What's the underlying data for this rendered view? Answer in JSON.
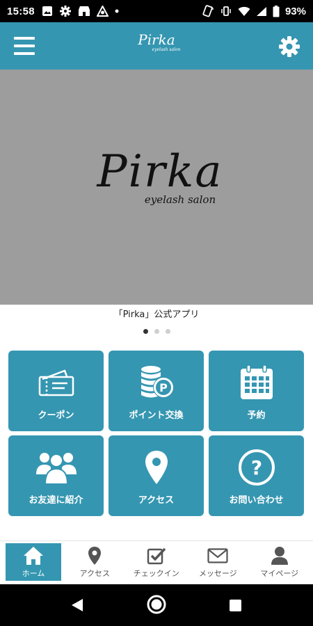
{
  "status_bar": {
    "time": "15:58",
    "battery": "93%"
  },
  "header": {
    "logo_text": "Pirka",
    "logo_subtext": "eyelash salon"
  },
  "banner": {
    "logo_text": "Pirka",
    "logo_subtext": "eyelash salon",
    "caption": "「Pirka」公式アプリ",
    "slides_total": 3,
    "slide_active": 1
  },
  "menu": [
    {
      "label": "クーポン",
      "icon": "ticket-icon"
    },
    {
      "label": "ポイント交換",
      "icon": "coins-p-icon"
    },
    {
      "label": "予約",
      "icon": "calendar-icon"
    },
    {
      "label": "お友達に紹介",
      "icon": "people-icon"
    },
    {
      "label": "アクセス",
      "icon": "map-pin-icon"
    },
    {
      "label": "お問い合わせ",
      "icon": "question-icon"
    }
  ],
  "tabbar": [
    {
      "label": "ホーム",
      "icon": "home-icon",
      "active": true
    },
    {
      "label": "アクセス",
      "icon": "map-pin-icon"
    },
    {
      "label": "チェックイン",
      "icon": "checkbox-icon"
    },
    {
      "label": "メッセージ",
      "icon": "envelope-icon"
    },
    {
      "label": "マイページ",
      "icon": "person-icon"
    }
  ],
  "colors": {
    "accent": "#3596b1",
    "banner_bg": "#9d9d9d"
  }
}
